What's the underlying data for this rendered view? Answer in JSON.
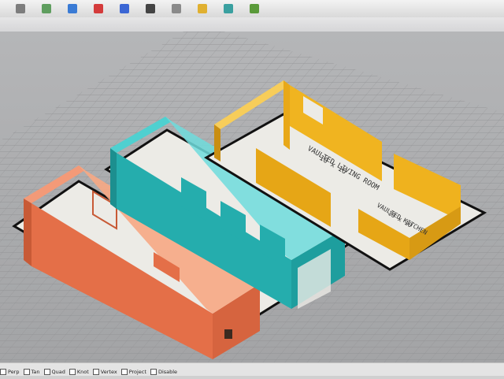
{
  "toolbar": {
    "icons": [
      {
        "name": "layer-icon",
        "color": "#7d7d7d"
      },
      {
        "name": "shade-icon",
        "color": "#5f9e5f"
      },
      {
        "name": "render-icon",
        "color": "#3a7bd5"
      },
      {
        "name": "sphere-red-icon",
        "color": "#d43b3b"
      },
      {
        "name": "sphere-blue-icon",
        "color": "#3b66d4"
      },
      {
        "name": "material-icon",
        "color": "#444444"
      },
      {
        "name": "gear-icon",
        "color": "#8a8a8a"
      },
      {
        "name": "light-icon",
        "color": "#e0b030"
      },
      {
        "name": "globe-icon",
        "color": "#3aa0a0"
      },
      {
        "name": "render-preview-icon",
        "color": "#5a9a3a"
      }
    ]
  },
  "viewport": {
    "name": "Perspective",
    "room_labels": [
      {
        "text": "VAULTED LIVING ROOM",
        "dim": "10 x 16"
      },
      {
        "text": "VAULTED KITCHEN",
        "dim": "10 x 10"
      }
    ],
    "colors": {
      "background": "#aeafb1",
      "grid": "#8f9092",
      "floor": "#ecebe6",
      "orange_model": "#e8744e",
      "cyan_model": "#2ab5b5",
      "yellow_model": "#f2b21f"
    }
  },
  "statusbar": {
    "snaps": [
      {
        "label": "Perp",
        "checked": false
      },
      {
        "label": "Tan",
        "checked": false
      },
      {
        "label": "Quad",
        "checked": false
      },
      {
        "label": "Knot",
        "checked": false
      },
      {
        "label": "Vertex",
        "checked": false
      },
      {
        "label": "Project",
        "checked": false
      },
      {
        "label": "Disable",
        "checked": false
      }
    ]
  }
}
